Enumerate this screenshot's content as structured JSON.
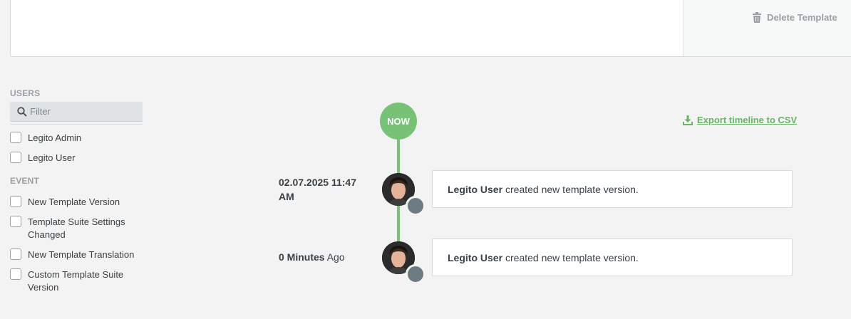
{
  "header": {
    "delete_template_label": "Delete Template"
  },
  "filters": {
    "users_title": "USERS",
    "filter_placeholder": "Filter",
    "users": [
      {
        "label": "Legito Admin",
        "checked": false
      },
      {
        "label": "Legito User",
        "checked": false
      }
    ],
    "event_title": "EVENT",
    "events": [
      {
        "label": "New Template Version",
        "checked": false
      },
      {
        "label": "Template Suite Settings Changed",
        "checked": false
      },
      {
        "label": "New Template Translation",
        "checked": false
      },
      {
        "label": "Custom Template Suite Version",
        "checked": false
      }
    ]
  },
  "timeline": {
    "now_label": "NOW",
    "export_label": "Export timeline to CSV",
    "entries": [
      {
        "time": "02.07.2025 11:47 AM",
        "user": "Legito User",
        "action": "created new template version."
      },
      {
        "time_bold": "0 Minutes",
        "time_rest": "Ago",
        "user": "Legito User",
        "action": "created new template version."
      }
    ]
  },
  "colors": {
    "accent_green": "#78c278",
    "badge_gray": "#6e7b83",
    "background": "#f2f3f2"
  }
}
